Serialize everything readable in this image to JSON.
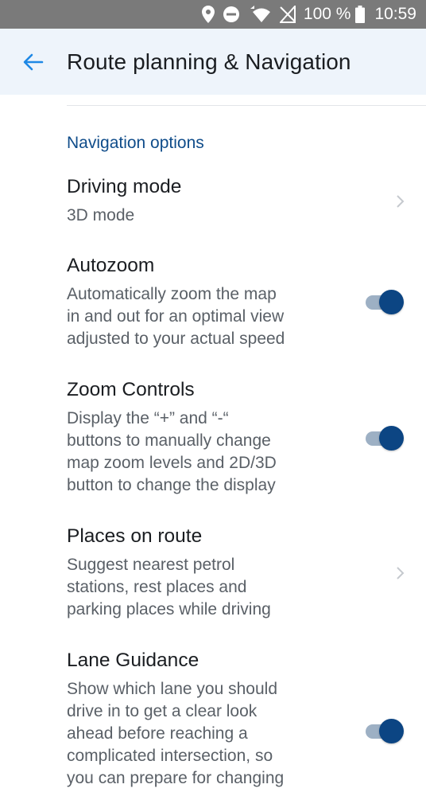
{
  "status_bar": {
    "battery": "100 %",
    "time": "10:59"
  },
  "header": {
    "title": "Route planning & Navigation"
  },
  "section": {
    "title": "Navigation options"
  },
  "settings": [
    {
      "title": "Driving mode",
      "desc": "3D mode",
      "control": "chevron"
    },
    {
      "title": "Autozoom",
      "desc": "Automatically zoom the map\nin and out for an optimal view\nadjusted to your actual speed",
      "control": "toggle",
      "enabled": true
    },
    {
      "title": "Zoom Controls",
      "desc": "Display the “+” and “-“\nbuttons to manually change\nmap zoom levels and 2D/3D\nbutton to change the display",
      "control": "toggle",
      "enabled": true
    },
    {
      "title": "Places on route",
      "desc": "Suggest nearest petrol\nstations, rest places and\nparking places while driving",
      "control": "chevron"
    },
    {
      "title": "Lane Guidance",
      "desc": "Show which lane you should\ndrive in to get a clear look\nahead before reaching a\ncomplicated intersection, so\nyou can prepare for changing",
      "control": "toggle",
      "enabled": true
    }
  ],
  "colors": {
    "accent": "#0c4583",
    "section_title": "#0f4c8a",
    "app_bar_bg": "#eef4fb",
    "back_arrow": "#1e88e5",
    "status_bar_bg": "#7a7a7a"
  }
}
